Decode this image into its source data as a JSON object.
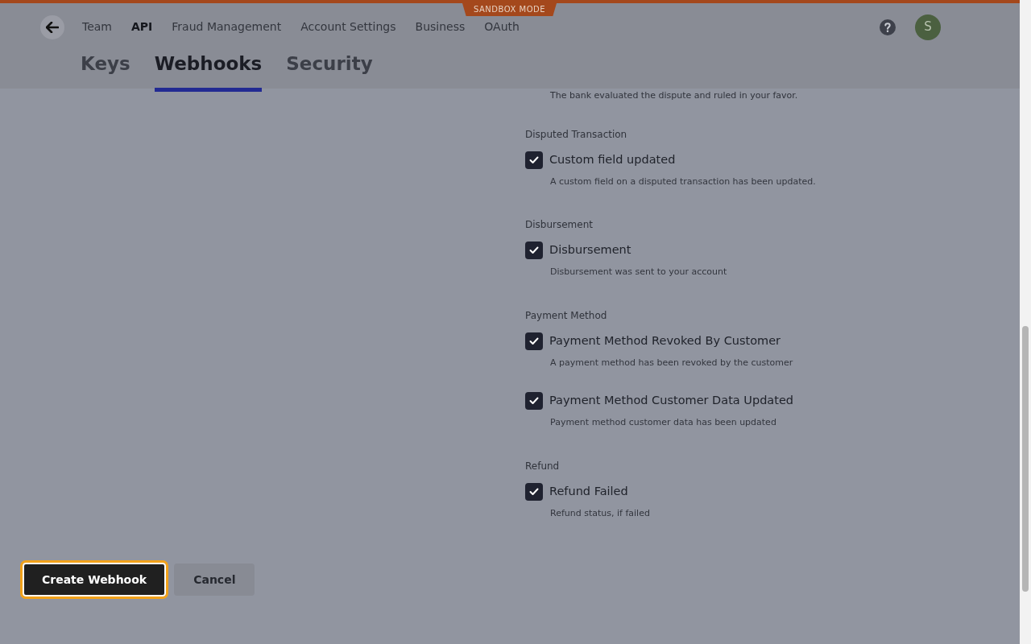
{
  "banner": {
    "label": "SANDBOX MODE"
  },
  "nav": {
    "items": [
      {
        "label": "Team",
        "selected": false
      },
      {
        "label": "API",
        "selected": true
      },
      {
        "label": "Fraud Management",
        "selected": false
      },
      {
        "label": "Account Settings",
        "selected": false
      },
      {
        "label": "Business",
        "selected": false
      },
      {
        "label": "OAuth",
        "selected": false
      }
    ],
    "avatar": "S"
  },
  "tabs": [
    {
      "label": "Keys",
      "selected": false
    },
    {
      "label": "Webhooks",
      "selected": true
    },
    {
      "label": "Security",
      "selected": false
    }
  ],
  "partial_description": "The bank evaluated the dispute and ruled in your favor.",
  "groups": [
    {
      "title": "Disputed Transaction",
      "events": [
        {
          "label": "Custom field updated",
          "description": "A custom field on a disputed transaction has been updated.",
          "checked": true
        }
      ]
    },
    {
      "title": "Disbursement",
      "events": [
        {
          "label": "Disbursement",
          "description": "Disbursement was sent to your account",
          "checked": true
        }
      ]
    },
    {
      "title": "Payment Method",
      "events": [
        {
          "label": "Payment Method Revoked By Customer",
          "description": "A payment method has been revoked by the customer",
          "checked": true
        },
        {
          "label": "Payment Method Customer Data Updated",
          "description": "Payment method customer data has been updated",
          "checked": true
        }
      ]
    },
    {
      "title": "Refund",
      "events": [
        {
          "label": "Refund Failed",
          "description": "Refund status, if failed",
          "checked": true
        }
      ]
    }
  ],
  "buttons": [
    {
      "label": "Create Webhook",
      "kind": "primary"
    },
    {
      "label": "Cancel",
      "kind": "secondary"
    }
  ]
}
